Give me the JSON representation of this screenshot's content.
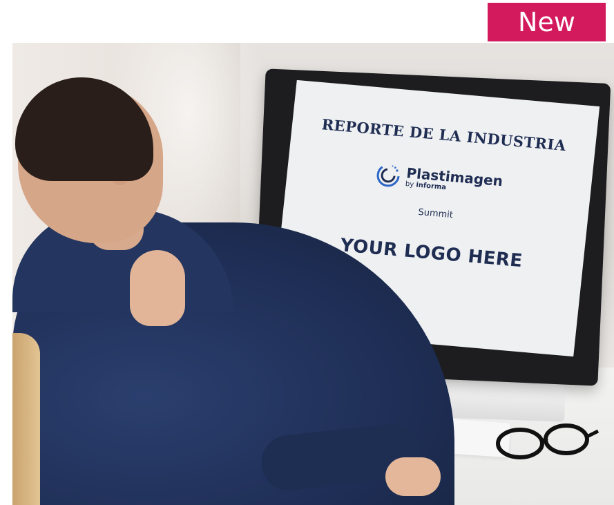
{
  "badge": {
    "label": "New",
    "color": "#d31a5c"
  },
  "screen": {
    "title": "REPORTE DE LA INDUSTRIA",
    "logo_name": "Plastimagen",
    "logo_by": "by",
    "logo_brand": "informa",
    "subtitle": "Summit",
    "placeholder": "YOUR LOGO HERE"
  },
  "icons": {
    "logo": "plastimagen-logo-icon",
    "glasses": "eyeglasses-icon"
  }
}
